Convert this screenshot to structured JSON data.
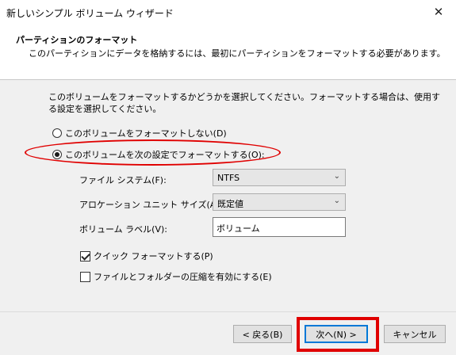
{
  "window": {
    "title": "新しいシンプル ボリューム ウィザード",
    "close_glyph": "✕"
  },
  "header": {
    "title": "パーティションのフォーマット",
    "subtitle": "このパーティションにデータを格納するには、最初にパーティションをフォーマットする必要があります。"
  },
  "intro_text": "このボリュームをフォーマットするかどうかを選択してください。フォーマットする場合は、使用する設定を選択してください。",
  "options": {
    "no_format": {
      "label": "このボリュームをフォーマットしない(D)",
      "selected": false
    },
    "format": {
      "label": "このボリュームを次の設定でフォーマットする(O):",
      "selected": true
    }
  },
  "fields": {
    "file_system": {
      "label": "ファイル システム(F):",
      "value": "NTFS"
    },
    "allocation_unit": {
      "label": "アロケーション ユニット サイズ(A):",
      "value": "既定値"
    },
    "volume_label": {
      "label": "ボリューム ラベル(V):",
      "value": "ボリューム"
    }
  },
  "checkboxes": {
    "quick_format": {
      "label": "クイック フォーマットする(P)",
      "checked": true
    },
    "compression": {
      "label": "ファイルとフォルダーの圧縮を有効にする(E)",
      "checked": false
    }
  },
  "buttons": {
    "back": "< 戻る(B)",
    "next": "次へ(N) >",
    "cancel": "キャンセル"
  },
  "icons": {
    "dropdown": "chevron-down-icon",
    "close": "close-icon"
  },
  "colors": {
    "highlight": "#e00000",
    "default_button_border": "#0078d7"
  }
}
